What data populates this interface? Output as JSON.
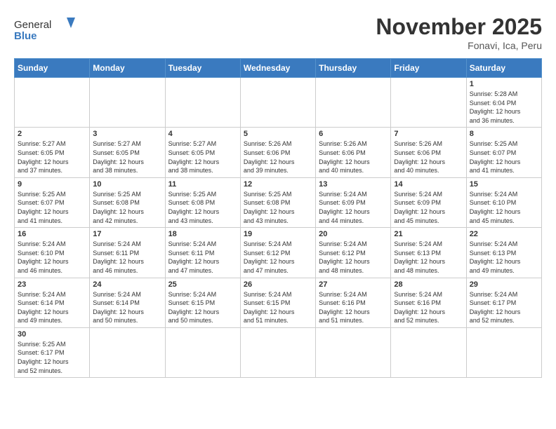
{
  "header": {
    "logo_general": "General",
    "logo_blue": "Blue",
    "month_title": "November 2025",
    "location": "Fonavi, Ica, Peru"
  },
  "days_of_week": [
    "Sunday",
    "Monday",
    "Tuesday",
    "Wednesday",
    "Thursday",
    "Friday",
    "Saturday"
  ],
  "weeks": [
    [
      {
        "day": "",
        "info": ""
      },
      {
        "day": "",
        "info": ""
      },
      {
        "day": "",
        "info": ""
      },
      {
        "day": "",
        "info": ""
      },
      {
        "day": "",
        "info": ""
      },
      {
        "day": "",
        "info": ""
      },
      {
        "day": "1",
        "info": "Sunrise: 5:28 AM\nSunset: 6:04 PM\nDaylight: 12 hours\nand 36 minutes."
      }
    ],
    [
      {
        "day": "2",
        "info": "Sunrise: 5:27 AM\nSunset: 6:05 PM\nDaylight: 12 hours\nand 37 minutes."
      },
      {
        "day": "3",
        "info": "Sunrise: 5:27 AM\nSunset: 6:05 PM\nDaylight: 12 hours\nand 38 minutes."
      },
      {
        "day": "4",
        "info": "Sunrise: 5:27 AM\nSunset: 6:05 PM\nDaylight: 12 hours\nand 38 minutes."
      },
      {
        "day": "5",
        "info": "Sunrise: 5:26 AM\nSunset: 6:06 PM\nDaylight: 12 hours\nand 39 minutes."
      },
      {
        "day": "6",
        "info": "Sunrise: 5:26 AM\nSunset: 6:06 PM\nDaylight: 12 hours\nand 40 minutes."
      },
      {
        "day": "7",
        "info": "Sunrise: 5:26 AM\nSunset: 6:06 PM\nDaylight: 12 hours\nand 40 minutes."
      },
      {
        "day": "8",
        "info": "Sunrise: 5:25 AM\nSunset: 6:07 PM\nDaylight: 12 hours\nand 41 minutes."
      }
    ],
    [
      {
        "day": "9",
        "info": "Sunrise: 5:25 AM\nSunset: 6:07 PM\nDaylight: 12 hours\nand 41 minutes."
      },
      {
        "day": "10",
        "info": "Sunrise: 5:25 AM\nSunset: 6:08 PM\nDaylight: 12 hours\nand 42 minutes."
      },
      {
        "day": "11",
        "info": "Sunrise: 5:25 AM\nSunset: 6:08 PM\nDaylight: 12 hours\nand 43 minutes."
      },
      {
        "day": "12",
        "info": "Sunrise: 5:25 AM\nSunset: 6:08 PM\nDaylight: 12 hours\nand 43 minutes."
      },
      {
        "day": "13",
        "info": "Sunrise: 5:24 AM\nSunset: 6:09 PM\nDaylight: 12 hours\nand 44 minutes."
      },
      {
        "day": "14",
        "info": "Sunrise: 5:24 AM\nSunset: 6:09 PM\nDaylight: 12 hours\nand 45 minutes."
      },
      {
        "day": "15",
        "info": "Sunrise: 5:24 AM\nSunset: 6:10 PM\nDaylight: 12 hours\nand 45 minutes."
      }
    ],
    [
      {
        "day": "16",
        "info": "Sunrise: 5:24 AM\nSunset: 6:10 PM\nDaylight: 12 hours\nand 46 minutes."
      },
      {
        "day": "17",
        "info": "Sunrise: 5:24 AM\nSunset: 6:11 PM\nDaylight: 12 hours\nand 46 minutes."
      },
      {
        "day": "18",
        "info": "Sunrise: 5:24 AM\nSunset: 6:11 PM\nDaylight: 12 hours\nand 47 minutes."
      },
      {
        "day": "19",
        "info": "Sunrise: 5:24 AM\nSunset: 6:12 PM\nDaylight: 12 hours\nand 47 minutes."
      },
      {
        "day": "20",
        "info": "Sunrise: 5:24 AM\nSunset: 6:12 PM\nDaylight: 12 hours\nand 48 minutes."
      },
      {
        "day": "21",
        "info": "Sunrise: 5:24 AM\nSunset: 6:13 PM\nDaylight: 12 hours\nand 48 minutes."
      },
      {
        "day": "22",
        "info": "Sunrise: 5:24 AM\nSunset: 6:13 PM\nDaylight: 12 hours\nand 49 minutes."
      }
    ],
    [
      {
        "day": "23",
        "info": "Sunrise: 5:24 AM\nSunset: 6:14 PM\nDaylight: 12 hours\nand 49 minutes."
      },
      {
        "day": "24",
        "info": "Sunrise: 5:24 AM\nSunset: 6:14 PM\nDaylight: 12 hours\nand 50 minutes."
      },
      {
        "day": "25",
        "info": "Sunrise: 5:24 AM\nSunset: 6:15 PM\nDaylight: 12 hours\nand 50 minutes."
      },
      {
        "day": "26",
        "info": "Sunrise: 5:24 AM\nSunset: 6:15 PM\nDaylight: 12 hours\nand 51 minutes."
      },
      {
        "day": "27",
        "info": "Sunrise: 5:24 AM\nSunset: 6:16 PM\nDaylight: 12 hours\nand 51 minutes."
      },
      {
        "day": "28",
        "info": "Sunrise: 5:24 AM\nSunset: 6:16 PM\nDaylight: 12 hours\nand 52 minutes."
      },
      {
        "day": "29",
        "info": "Sunrise: 5:24 AM\nSunset: 6:17 PM\nDaylight: 12 hours\nand 52 minutes."
      }
    ],
    [
      {
        "day": "30",
        "info": "Sunrise: 5:25 AM\nSunset: 6:17 PM\nDaylight: 12 hours\nand 52 minutes."
      },
      {
        "day": "",
        "info": ""
      },
      {
        "day": "",
        "info": ""
      },
      {
        "day": "",
        "info": ""
      },
      {
        "day": "",
        "info": ""
      },
      {
        "day": "",
        "info": ""
      },
      {
        "day": "",
        "info": ""
      }
    ]
  ]
}
